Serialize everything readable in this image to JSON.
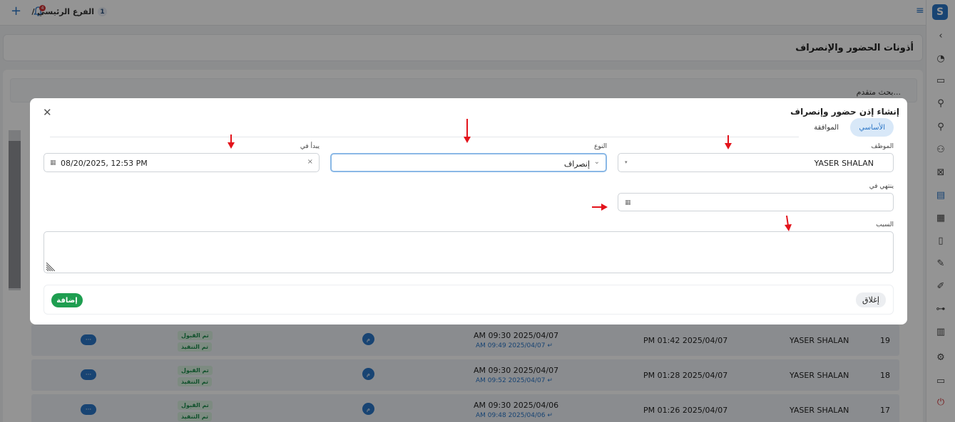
{
  "topbar": {
    "branch_label": "الفرع الرئيسي /",
    "branch_number": "1",
    "notification_count": "4"
  },
  "page": {
    "title": "أذونات الحضور والإنصراف",
    "advanced_search": "بحث متقدم..."
  },
  "rows": [
    {
      "num": "19",
      "employee": "YASER SHALAN",
      "end_time": "PM 01:42 2025/04/07",
      "start_time": "AM 09:30 2025/04/07",
      "actual": "AM 09:49 2025/04/07 ↵",
      "type_badge": "م",
      "status1": "تم القبول",
      "status2": "تم التنفيذ",
      "actions": "···"
    },
    {
      "num": "18",
      "employee": "YASER SHALAN",
      "end_time": "PM 01:28 2025/04/07",
      "start_time": "AM 09:30 2025/04/07",
      "actual": "AM 09:52 2025/04/07 ↵",
      "type_badge": "م",
      "status1": "تم القبول",
      "status2": "تم التنفيذ",
      "actions": "···"
    },
    {
      "num": "17",
      "employee": "YASER SHALAN",
      "end_time": "PM 01:26 2025/04/07",
      "start_time": "AM 09:30 2025/04/06",
      "actual": "AM 09:48 2025/04/06 ↵",
      "type_badge": "م",
      "status1": "تم القبول",
      "status2": "تم التنفيذ",
      "actions": "···"
    }
  ],
  "modal": {
    "title": "إنشاء إذن حضور وإنصراف",
    "tabs": {
      "basic": "الأساسي",
      "approval": "الموافقة"
    },
    "fields": {
      "employee_label": "الموظف",
      "employee_value": "YASER SHALAN",
      "type_label": "النوع",
      "type_value": "إنصراف",
      "start_label": "يبدأ في",
      "start_value": "08/20/2025, 12:53 PM",
      "end_label": "ينتهي في",
      "end_value": "",
      "reason_label": "السبب"
    },
    "buttons": {
      "add": "إضافة",
      "close": "إغلاق"
    }
  },
  "colors": {
    "accent": "#2a75c6",
    "success": "#1e9e50",
    "annotation_arrow": "#e3131b"
  }
}
